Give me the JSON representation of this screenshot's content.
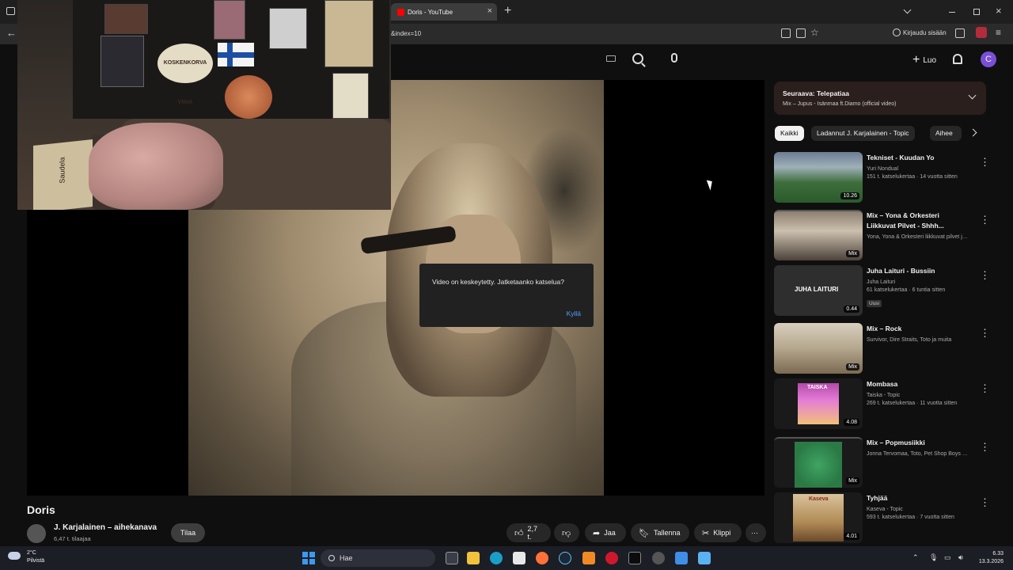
{
  "browser": {
    "tab_title": "Doris - YouTube",
    "new_tab_label": "+",
    "url_fragment": "&index=10",
    "sign_in": "Kirjaudu sisään"
  },
  "header": {
    "create_label": "Luo",
    "avatar_letter": "C"
  },
  "player": {
    "dialog_message": "Video on keskeytetty. Jatketaanko katselua?",
    "dialog_confirm": "Kyllä",
    "webcam_box_text": "Saudela",
    "webcam_sign_text": "KOSKENKORVA VIINA"
  },
  "video": {
    "title": "Doris",
    "channel_name": "J. Karjalainen – aihekanava",
    "channel_subs": "6,47 t. tilaajaa",
    "subscribe_label": "Tilaa",
    "like_count": "2,7 t.",
    "share_label": "Jaa",
    "save_label": "Tallenna",
    "clip_label": "Klippi"
  },
  "up_next": {
    "title": "Seuraava: Telepatiaa",
    "subtitle": "Mix – Jupus - Isänmaa ft.Diamo (official video)"
  },
  "chips": [
    {
      "label": "Kaikki"
    },
    {
      "label": "Ladannut J. Karjalainen - Topic"
    },
    {
      "label": "Aihee"
    }
  ],
  "recommendations": [
    {
      "title": "Tekniset - Kuudan Yo",
      "channel": "Yuri Nondual",
      "stats": "151 t. katselukertaa · 14 vuotta sitten",
      "badge": "10.26",
      "tag": ""
    },
    {
      "title": "Mix – Yona & Orkesteri Liikkuvat Pilvet - Shhh...",
      "channel": "Yona, Yona & Orkesteri liikkuvat pilvet ja ...",
      "stats": "",
      "badge": "Mix",
      "tag": ""
    },
    {
      "title": "Juha Laituri - Bussiin",
      "channel": "Juha Laituri",
      "stats": "61 katselukertaa · 6 tuntia sitten",
      "badge": "0.44",
      "tag": "Uusi",
      "thumb_text": "JUHA LAITURI"
    },
    {
      "title": "Mix – Rock",
      "channel": "Survivor, Dire Straits, Toto ja muita",
      "stats": "",
      "badge": "Mix",
      "tag": ""
    },
    {
      "title": "Mombasa",
      "channel": "Taiska - Topic",
      "stats": "269 t. katselukertaa · 11 vuotta sitten",
      "badge": "4.08",
      "tag": "",
      "thumb_text": "TAISKA"
    },
    {
      "title": "Mix – Popmusiikki",
      "channel": "Jonna Tervomaa, Toto, Pet Shop Boys ja ...",
      "stats": "",
      "badge": "Mix",
      "tag": ""
    },
    {
      "title": "Tyhjää",
      "channel": "Kaseva - Topic",
      "stats": "593 t. katselukertaa · 7 vuotta sitten",
      "badge": "4.01",
      "tag": "",
      "thumb_text": "Kaseva"
    }
  ],
  "taskbar": {
    "weather_temp": "2°C",
    "weather_desc": "Pilvistä",
    "search_label": "Hae",
    "time": "6.33",
    "date": "13.3.2026"
  },
  "colors": {
    "accent_blue": "#4ea1ff",
    "youtube_red": "#ff0000",
    "avatar_purple": "#7a4fd6"
  }
}
